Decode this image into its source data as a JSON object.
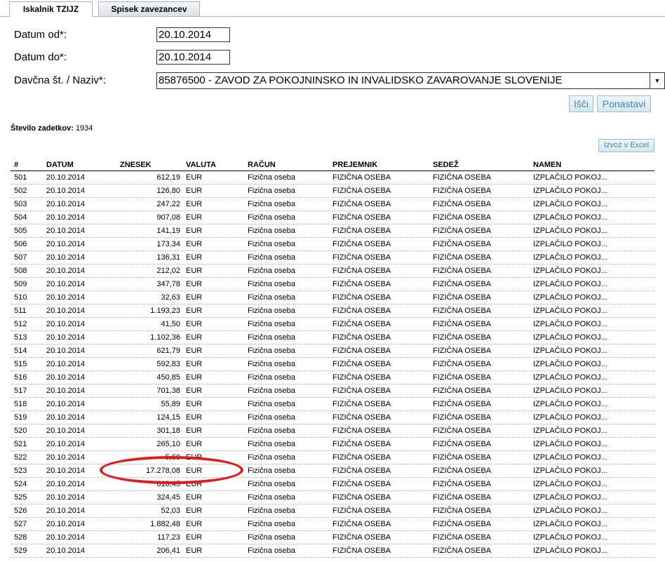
{
  "tabs": [
    {
      "label": "Iskalnik TZIJZ",
      "active": true
    },
    {
      "label": "Spisek zavezancev",
      "active": false
    }
  ],
  "form": {
    "date_from_label": "Datum od*:",
    "date_from_value": "20.10.2014",
    "date_to_label": "Datum do*:",
    "date_to_value": "20.10.2014",
    "tax_label": "Davčna št. / Naziv*:",
    "tax_value": "85876500 - ZAVOD ZA POKOJNINSKO IN INVALIDSKO ZAVAROVANJE SLOVENIJE",
    "search_button": "Išči",
    "reset_button": "Ponastavi"
  },
  "results": {
    "count_label": "Število zadetkov:",
    "count_value": "1934",
    "excel_button": "Izvoz v Excel"
  },
  "table": {
    "columns": [
      "#",
      "DATUM",
      "ZNESEK",
      "VALUTA",
      "RAČUN",
      "PREJEMNIK",
      "SEDEŽ",
      "NAMEN"
    ],
    "rows": [
      [
        "501",
        "20.10.2014",
        "612,19",
        "EUR",
        "Fizična oseba",
        "FIZIČNA OSEBA",
        "FIZIČNA OSEBA",
        "IZPLAČILO POKOJ..."
      ],
      [
        "502",
        "20.10.2014",
        "126,80",
        "EUR",
        "Fizična oseba",
        "FIZIČNA OSEBA",
        "FIZIČNA OSEBA",
        "IZPLAČILO POKOJ..."
      ],
      [
        "503",
        "20.10.2014",
        "247,22",
        "EUR",
        "Fizična oseba",
        "FIZIČNA OSEBA",
        "FIZIČNA OSEBA",
        "IZPLAČILO POKOJ..."
      ],
      [
        "504",
        "20.10.2014",
        "907,08",
        "EUR",
        "Fizična oseba",
        "FIZIČNA OSEBA",
        "FIZIČNA OSEBA",
        "IZPLAČILO POKOJ..."
      ],
      [
        "505",
        "20.10.2014",
        "141,19",
        "EUR",
        "Fizična oseba",
        "FIZIČNA OSEBA",
        "FIZIČNA OSEBA",
        "IZPLAČILO POKOJ..."
      ],
      [
        "506",
        "20.10.2014",
        "173,34",
        "EUR",
        "Fizična oseba",
        "FIZIČNA OSEBA",
        "FIZIČNA OSEBA",
        "IZPLAČILO POKOJ..."
      ],
      [
        "507",
        "20.10.2014",
        "136,31",
        "EUR",
        "Fizična oseba",
        "FIZIČNA OSEBA",
        "FIZIČNA OSEBA",
        "IZPLAČILO POKOJ..."
      ],
      [
        "508",
        "20.10.2014",
        "212,02",
        "EUR",
        "Fizična oseba",
        "FIZIČNA OSEBA",
        "FIZIČNA OSEBA",
        "IZPLAČILO POKOJ..."
      ],
      [
        "509",
        "20.10.2014",
        "347,78",
        "EUR",
        "Fizična oseba",
        "FIZIČNA OSEBA",
        "FIZIČNA OSEBA",
        "IZPLAČILO POKOJ..."
      ],
      [
        "510",
        "20.10.2014",
        "32,63",
        "EUR",
        "Fizična oseba",
        "FIZIČNA OSEBA",
        "FIZIČNA OSEBA",
        "IZPLAČILO POKOJ..."
      ],
      [
        "511",
        "20.10.2014",
        "1.193,23",
        "EUR",
        "Fizična oseba",
        "FIZIČNA OSEBA",
        "FIZIČNA OSEBA",
        "IZPLAČILO POKOJ..."
      ],
      [
        "512",
        "20.10.2014",
        "41,50",
        "EUR",
        "Fizična oseba",
        "FIZIČNA OSEBA",
        "FIZIČNA OSEBA",
        "IZPLAČILO POKOJ..."
      ],
      [
        "513",
        "20.10.2014",
        "1.102,36",
        "EUR",
        "Fizična oseba",
        "FIZIČNA OSEBA",
        "FIZIČNA OSEBA",
        "IZPLAČILO POKOJ..."
      ],
      [
        "514",
        "20.10.2014",
        "621,79",
        "EUR",
        "Fizična oseba",
        "FIZIČNA OSEBA",
        "FIZIČNA OSEBA",
        "IZPLAČILO POKOJ..."
      ],
      [
        "515",
        "20.10.2014",
        "592,83",
        "EUR",
        "Fizična oseba",
        "FIZIČNA OSEBA",
        "FIZIČNA OSEBA",
        "IZPLAČILO POKOJ..."
      ],
      [
        "516",
        "20.10.2014",
        "450,85",
        "EUR",
        "Fizična oseba",
        "FIZIČNA OSEBA",
        "FIZIČNA OSEBA",
        "IZPLAČILO POKOJ..."
      ],
      [
        "517",
        "20.10.2014",
        "701,38",
        "EUR",
        "Fizična oseba",
        "FIZIČNA OSEBA",
        "FIZIČNA OSEBA",
        "IZPLAČILO POKOJ..."
      ],
      [
        "518",
        "20.10.2014",
        "55,89",
        "EUR",
        "Fizična oseba",
        "FIZIČNA OSEBA",
        "FIZIČNA OSEBA",
        "IZPLAČILO POKOJ..."
      ],
      [
        "519",
        "20.10.2014",
        "124,15",
        "EUR",
        "Fizična oseba",
        "FIZIČNA OSEBA",
        "FIZIČNA OSEBA",
        "IZPLAČILO POKOJ..."
      ],
      [
        "520",
        "20.10.2014",
        "301,18",
        "EUR",
        "Fizična oseba",
        "FIZIČNA OSEBA",
        "FIZIČNA OSEBA",
        "IZPLAČILO POKOJ..."
      ],
      [
        "521",
        "20.10.2014",
        "265,10",
        "EUR",
        "Fizična oseba",
        "FIZIČNA OSEBA",
        "FIZIČNA OSEBA",
        "IZPLAČILO POKOJ..."
      ],
      [
        "522",
        "20.10.2014",
        "5,60",
        "EUR",
        "Fizična oseba",
        "FIZIČNA OSEBA",
        "FIZIČNA OSEBA",
        "IZPLAČILO POKOJ..."
      ],
      [
        "523",
        "20.10.2014",
        "17.278,08",
        "EUR",
        "Fizična oseba",
        "FIZIČNA OSEBA",
        "FIZIČNA OSEBA",
        "IZPLAČILO POKOJ..."
      ],
      [
        "524",
        "20.10.2014",
        "618,45",
        "EUR",
        "Fizična oseba",
        "FIZIČNA OSEBA",
        "FIZIČNA OSEBA",
        "IZPLAČILO POKOJ..."
      ],
      [
        "525",
        "20.10.2014",
        "324,45",
        "EUR",
        "Fizična oseba",
        "FIZIČNA OSEBA",
        "FIZIČNA OSEBA",
        "IZPLAČILO POKOJ..."
      ],
      [
        "526",
        "20.10.2014",
        "52,03",
        "EUR",
        "Fizična oseba",
        "FIZIČNA OSEBA",
        "FIZIČNA OSEBA",
        "IZPLAČILO POKOJ..."
      ],
      [
        "527",
        "20.10.2014",
        "1.882,48",
        "EUR",
        "Fizična oseba",
        "FIZIČNA OSEBA",
        "FIZIČNA OSEBA",
        "IZPLAČILO POKOJ..."
      ],
      [
        "528",
        "20.10.2014",
        "117,23",
        "EUR",
        "Fizična oseba",
        "FIZIČNA OSEBA",
        "FIZIČNA OSEBA",
        "IZPLAČILO POKOJ..."
      ],
      [
        "529",
        "20.10.2014",
        "206,41",
        "EUR",
        "Fizična oseba",
        "FIZIČNA OSEBA",
        "FIZIČNA OSEBA",
        "IZPLAČILO POKOJ..."
      ]
    ]
  },
  "annotation": {
    "color": "#e01b1b",
    "highlighted_row": "523",
    "shape": "red-ellipse"
  }
}
